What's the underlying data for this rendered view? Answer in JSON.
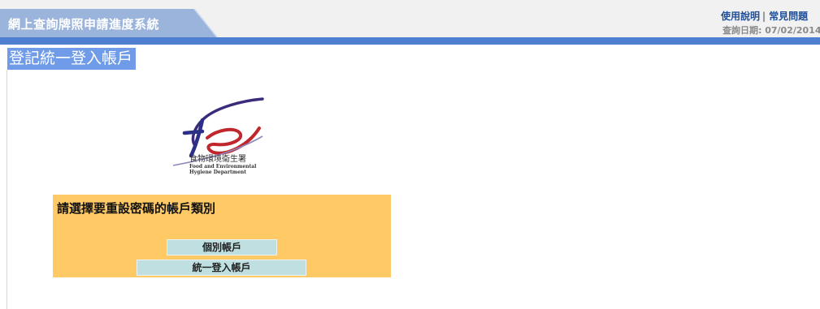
{
  "header": {
    "app_title": "網上查詢牌照申請進度系統",
    "help_link": "使用說明",
    "separator": "|",
    "faq_link": "常見問題",
    "query_date": "查詢日期: 07/02/2014"
  },
  "section": {
    "title": "登記統一登入帳戶"
  },
  "logo": {
    "name_cn": "食物環境衞生署",
    "name_en_line1": "Food and Environmental",
    "name_en_line2": "Hygiene Department"
  },
  "panel": {
    "heading": "請選擇要重設密碼的帳戶類別",
    "buttons": [
      {
        "label": "個別帳戶"
      },
      {
        "label": "統一登入帳戶"
      }
    ]
  },
  "colors": {
    "title_tab": "#9bb4dc",
    "blue_bar": "#4f7fd1",
    "section_title_bg": "#6f9be8",
    "panel_bg": "#ffca66",
    "button_bg": "#c0dfe0",
    "link": "#1f4f9c"
  }
}
